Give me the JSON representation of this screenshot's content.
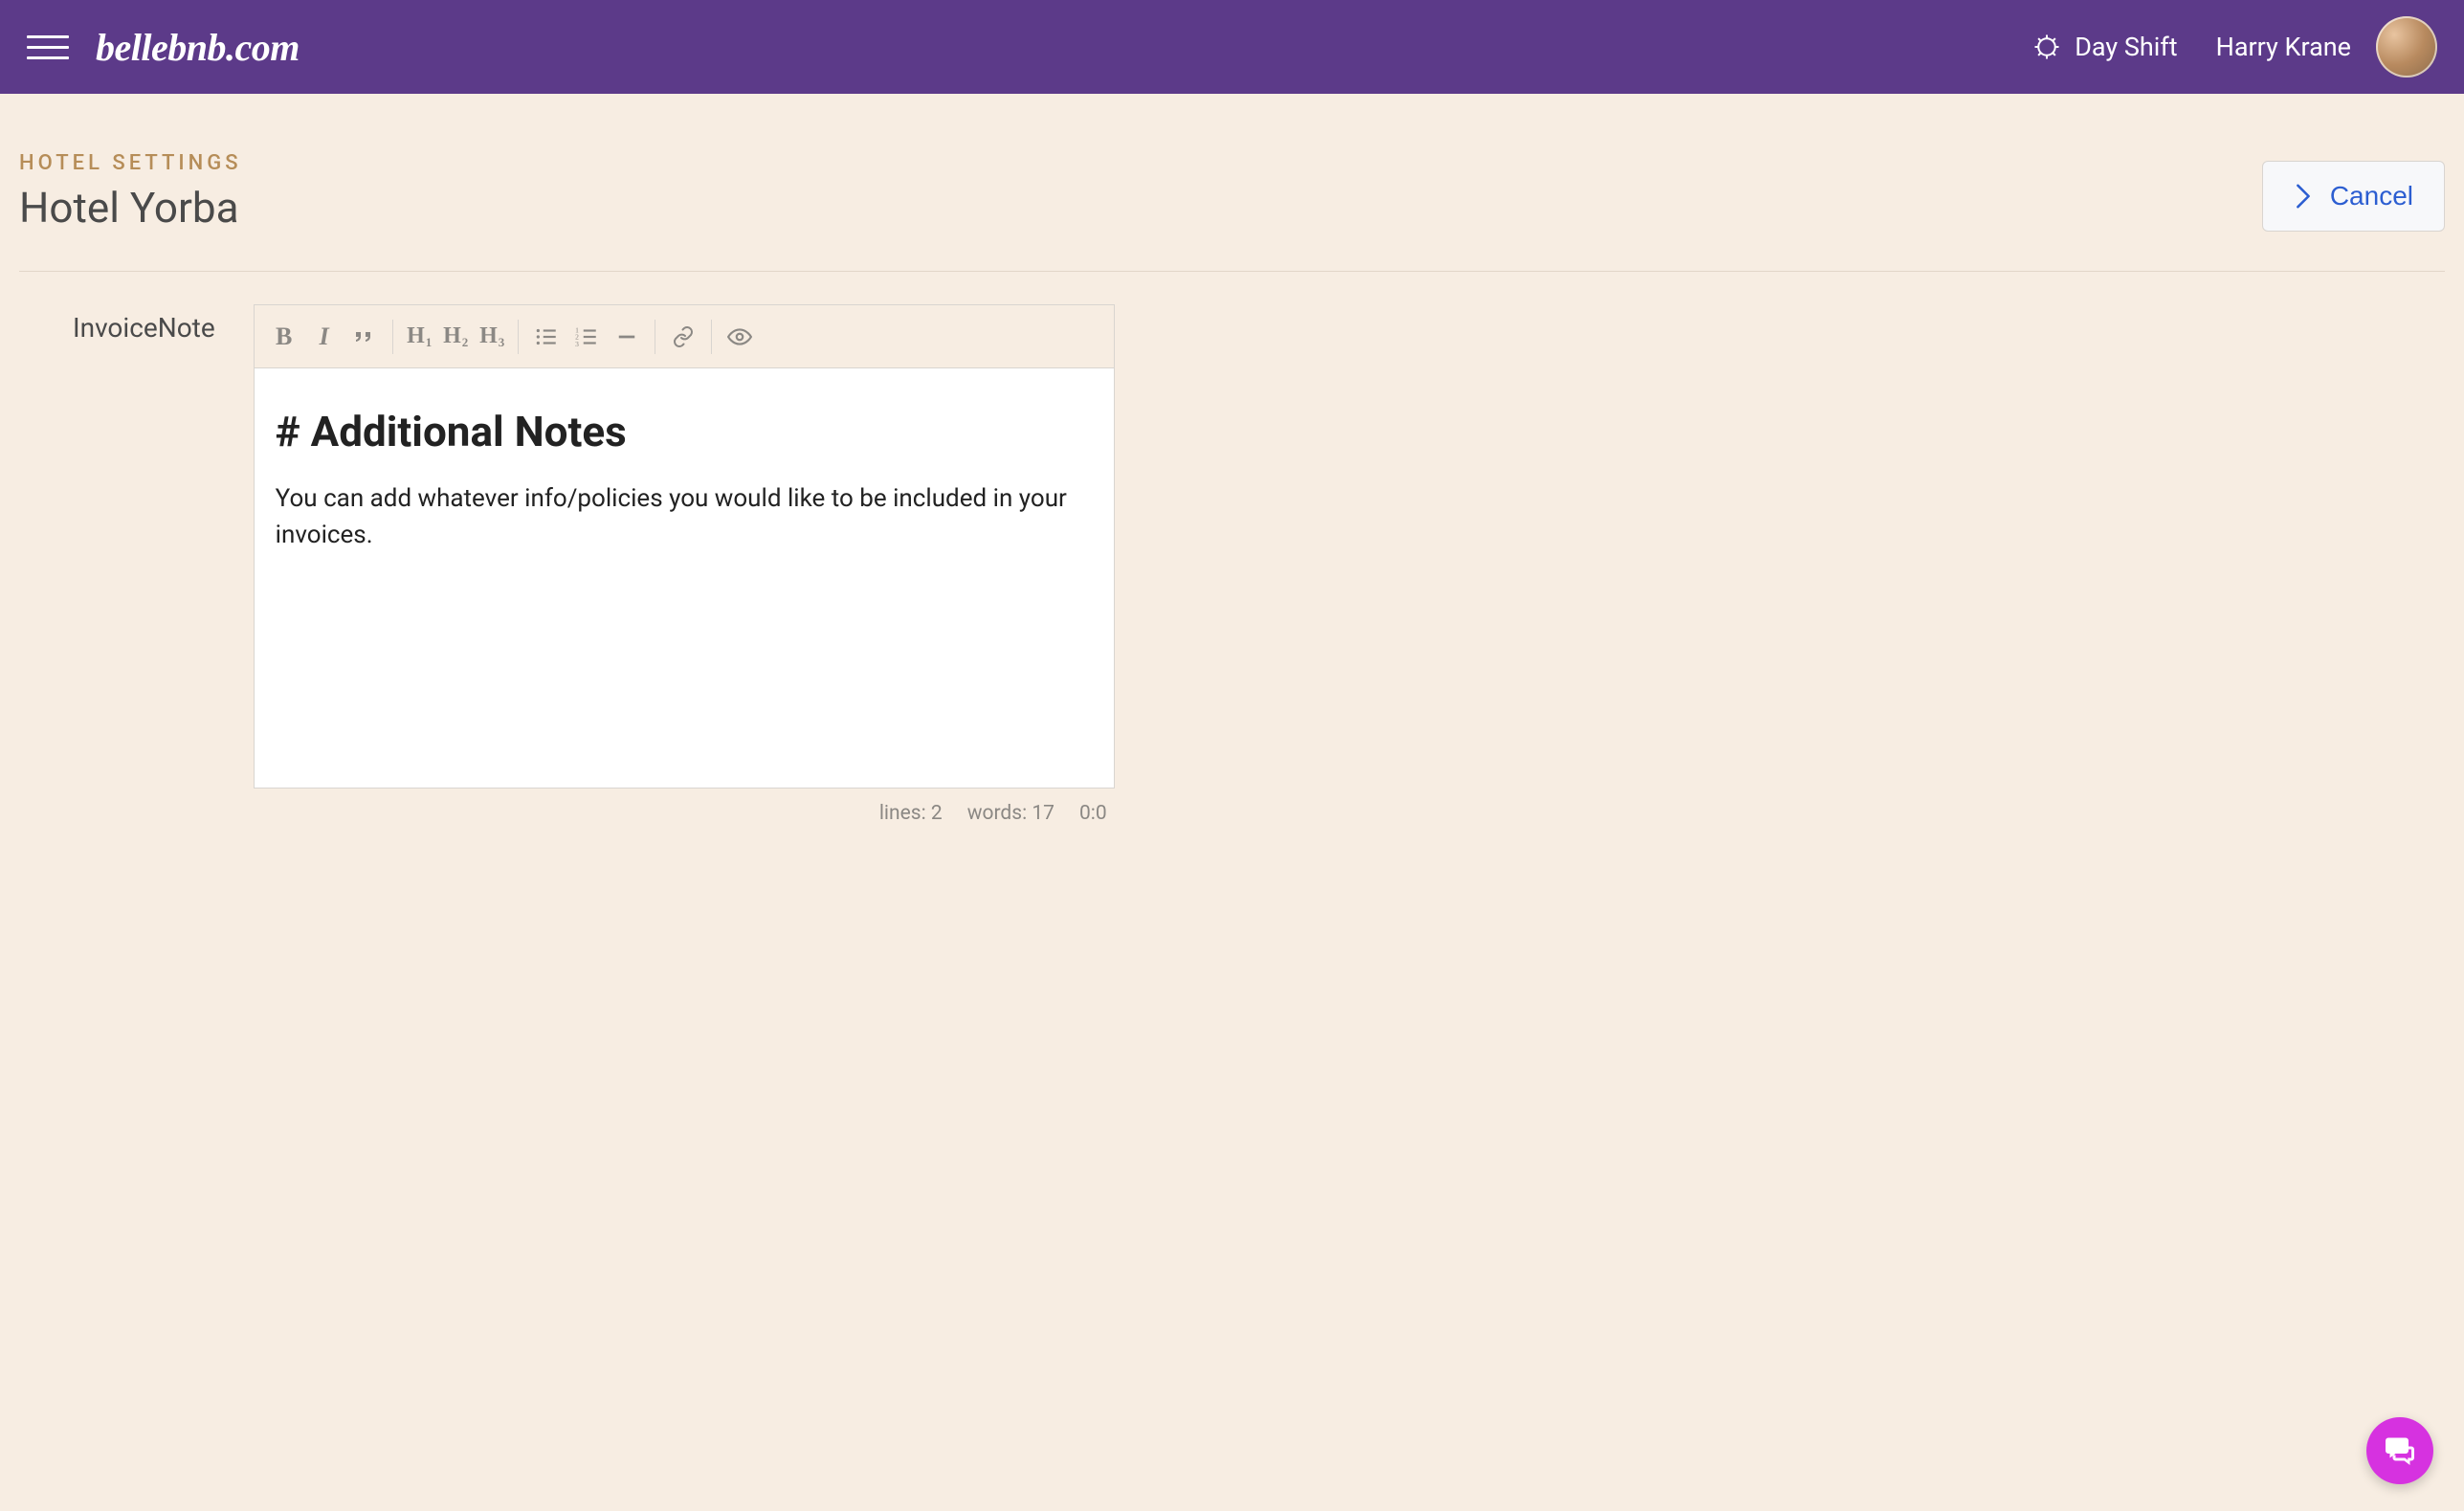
{
  "topbar": {
    "logo_text": "bellebnb.com",
    "shift_label": "Day Shift",
    "username": "Harry Krane"
  },
  "breadcrumb": {
    "section": "HOTEL SETTINGS",
    "title": "Hotel Yorba"
  },
  "actions": {
    "cancel_label": "Cancel"
  },
  "form": {
    "invoice_note_label": "InvoiceNote"
  },
  "editor": {
    "heading": "# Additional Notes",
    "body": "You can add whatever info/policies you would like to be included in your invoices.",
    "toolbar": {
      "bold": "B",
      "italic": "I",
      "quote": "❝",
      "h1": "H",
      "h1_sub": "1",
      "h2": "H",
      "h2_sub": "2",
      "h3": "H",
      "h3_sub": "3"
    },
    "status": {
      "lines_label": "lines: 2",
      "words_label": "words: 17",
      "cursor_label": "0:0"
    }
  }
}
